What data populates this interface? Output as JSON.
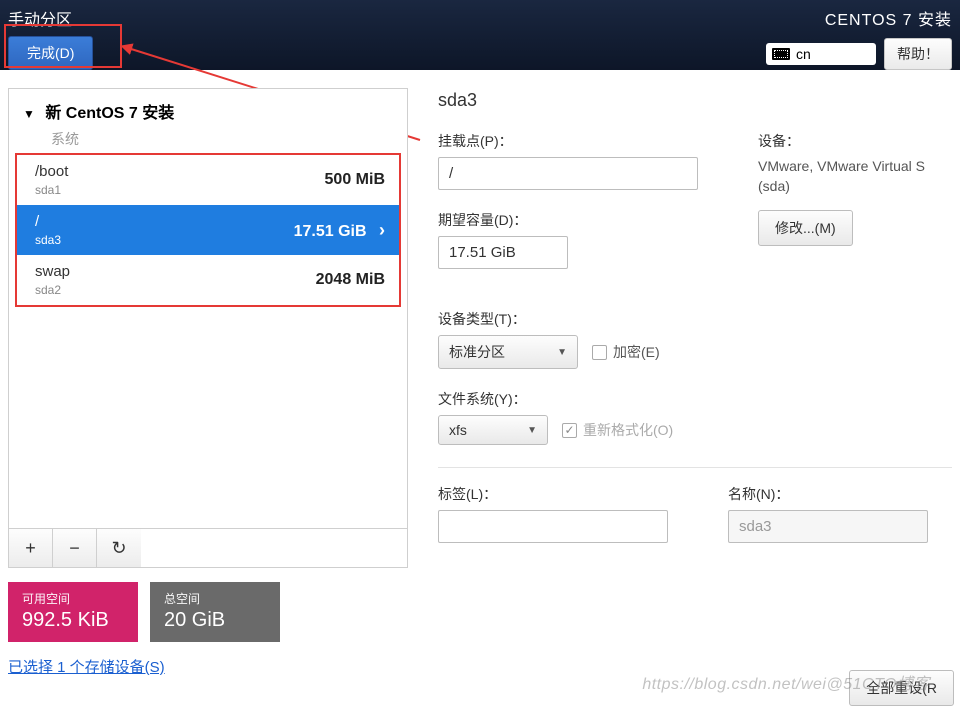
{
  "header": {
    "title": "手动分区",
    "done_label": "完成(D)",
    "install_title": "CENTOS 7 安装",
    "lang_code": "cn",
    "help_label": "帮助！"
  },
  "left": {
    "new_install_label": "新 CentOS 7 安装",
    "section_label": "系统",
    "items": [
      {
        "mount": "/boot",
        "device": "sda1",
        "size": "500 MiB",
        "selected": false
      },
      {
        "mount": "/",
        "device": "sda3",
        "size": "17.51 GiB",
        "selected": true
      },
      {
        "mount": "swap",
        "device": "sda2",
        "size": "2048 MiB",
        "selected": false
      }
    ],
    "buttons": {
      "add": "+",
      "remove": "−",
      "reload": "↻"
    },
    "free_label": "可用空间",
    "free_value": "992.5 KiB",
    "total_label": "总空间",
    "total_value": "20 GiB",
    "storage_link": "已选择 1 个存储设备(S)"
  },
  "right": {
    "title": "sda3",
    "mount_label": "挂载点(P)：",
    "mount_value": "/",
    "capacity_label": "期望容量(D)：",
    "capacity_value": "17.51 GiB",
    "device_label": "设备：",
    "device_value": "VMware, VMware Virtual S (sda)",
    "modify_label": "修改...(M)",
    "type_label": "设备类型(T)：",
    "type_value": "标准分区",
    "encrypt_label": "加密(E)",
    "fs_label": "文件系统(Y)：",
    "fs_value": "xfs",
    "reformat_label": "重新格式化(O)",
    "tag_label": "标签(L)：",
    "tag_value": "",
    "name_label": "名称(N)：",
    "name_value": "sda3",
    "reset_label": "全部重设(R"
  },
  "watermark": "https://blog.csdn.net/wei@51CTO博客"
}
